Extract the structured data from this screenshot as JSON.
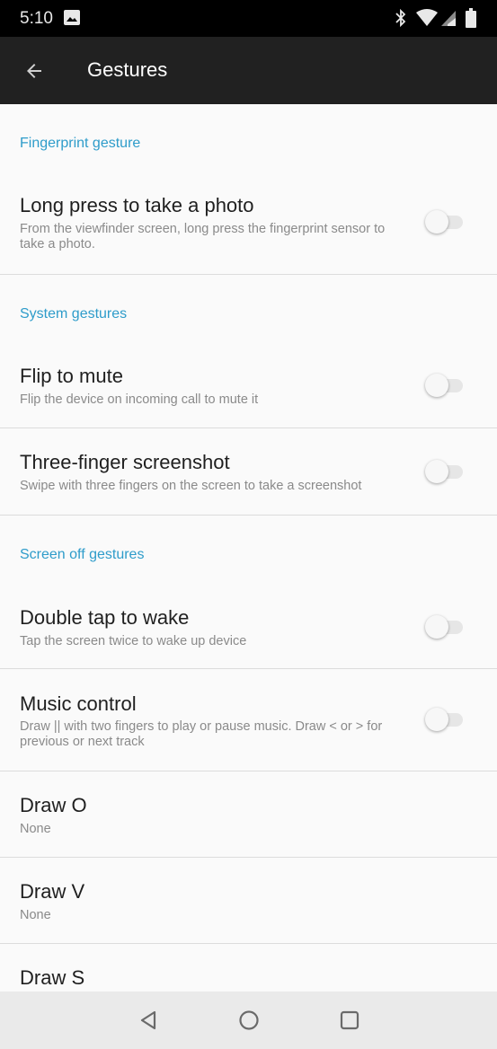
{
  "status_bar": {
    "time": "5:10",
    "icons": [
      "gallery-icon",
      "bluetooth-icon",
      "wifi-icon",
      "signal-icon",
      "battery-icon"
    ]
  },
  "app_bar": {
    "title": "Gestures",
    "back_icon": "arrow-back-icon"
  },
  "sections": {
    "fingerprint": {
      "header": "Fingerprint gesture",
      "long_press": {
        "title": "Long press to take a photo",
        "summary": "From the viewfinder screen, long press the fingerprint sensor to take a photo.",
        "enabled": false
      }
    },
    "system": {
      "header": "System gestures",
      "flip_to_mute": {
        "title": "Flip to mute",
        "summary": "Flip the device on incoming call to mute it",
        "enabled": false
      },
      "three_finger": {
        "title": "Three-finger screenshot",
        "summary": "Swipe with three fingers on the screen to take a screenshot",
        "enabled": false
      }
    },
    "screen_off": {
      "header": "Screen off gestures",
      "double_tap": {
        "title": "Double tap to wake",
        "summary": "Tap the screen twice to wake up device",
        "enabled": false
      },
      "music_control": {
        "title": "Music control",
        "summary": "Draw || with two fingers to play or pause music. Draw < or > for previous or next track",
        "enabled": false
      },
      "draw_o": {
        "title": "Draw O",
        "summary": "None"
      },
      "draw_v": {
        "title": "Draw V",
        "summary": "None"
      },
      "draw_s": {
        "title": "Draw S"
      }
    }
  },
  "nav_bar": {
    "icons": [
      "nav-back-icon",
      "nav-home-icon",
      "nav-recents-icon"
    ]
  },
  "colors": {
    "accent": "#2e9cca",
    "app_bar": "#212121",
    "background": "#fafafa"
  }
}
